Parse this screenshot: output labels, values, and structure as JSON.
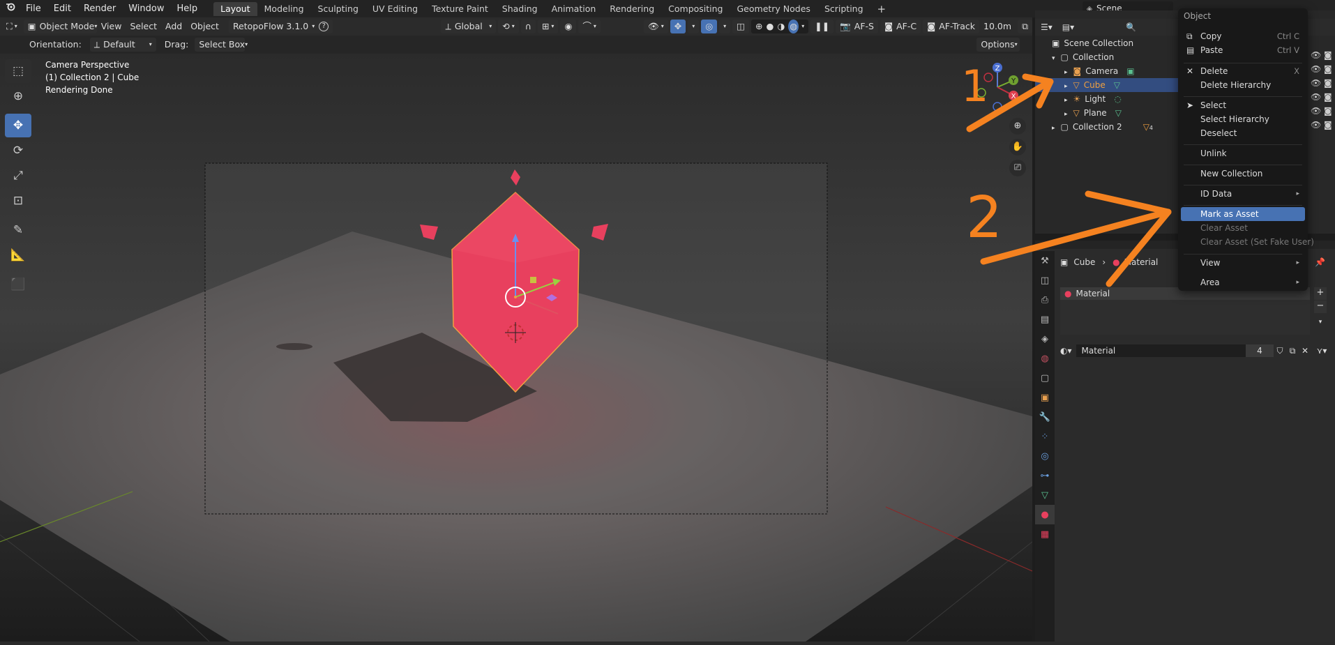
{
  "topbar": {
    "menus": [
      "File",
      "Edit",
      "Render",
      "Window",
      "Help"
    ],
    "workspaces": [
      "Layout",
      "Modeling",
      "Sculpting",
      "UV Editing",
      "Texture Paint",
      "Shading",
      "Animation",
      "Rendering",
      "Compositing",
      "Geometry Nodes",
      "Scripting"
    ],
    "active_workspace": "Layout",
    "add_tab": "+",
    "scene_name": "Scene"
  },
  "viewport_header": {
    "mode": "Object Mode",
    "menus": [
      "View",
      "Select",
      "Add",
      "Object"
    ],
    "addon": "RetopoFlow 3.1.0",
    "help": "?",
    "transform_orientation": "Global",
    "af_s": "AF-S",
    "af_c": "AF-C",
    "af_track": "AF-Track",
    "distance": "10.0m"
  },
  "tool_header": {
    "orientation_label": "Orientation:",
    "orientation_value": "Default",
    "drag_label": "Drag:",
    "drag_value": "Select Box",
    "options": "Options"
  },
  "viewport_overlay": {
    "line1": "Camera Perspective",
    "line2": "(1) Collection 2 | Cube",
    "line3": "Rendering Done"
  },
  "gizmo": {
    "z": "Z",
    "y": "Y",
    "x": "X"
  },
  "outliner": {
    "scene_collection": "Scene Collection",
    "collection": "Collection",
    "items": [
      "Camera",
      "Cube",
      "Light",
      "Plane"
    ],
    "selected_item": "Cube",
    "collection2": "Collection 2",
    "collection2_count": "4"
  },
  "properties": {
    "breadcrumb_object": "Cube",
    "breadcrumb_material": "Material",
    "slot_name": "Material",
    "material_name": "Material",
    "user_count": "4"
  },
  "context_menu": {
    "title": "Object",
    "items": [
      {
        "label": "Copy",
        "shortcut": "Ctrl C"
      },
      {
        "label": "Paste",
        "shortcut": "Ctrl V"
      },
      {
        "label": "Delete",
        "shortcut": "X"
      },
      {
        "label": "Delete Hierarchy"
      },
      {
        "label": "Select"
      },
      {
        "label": "Select Hierarchy"
      },
      {
        "label": "Deselect"
      },
      {
        "label": "Unlink"
      },
      {
        "label": "New Collection"
      },
      {
        "label": "ID Data"
      },
      {
        "label": "Mark as Asset"
      },
      {
        "label": "Clear Asset"
      },
      {
        "label": "Clear Asset (Set Fake User)"
      },
      {
        "label": "View"
      },
      {
        "label": "Area"
      }
    ],
    "highlighted": "Mark as Asset"
  },
  "annotations": {
    "step1": "1",
    "step2": "2"
  },
  "colors": {
    "accent": "#4772b3",
    "annotation": "#f58220",
    "cube": "#e8405e",
    "outliner_selected": "#334d80"
  }
}
